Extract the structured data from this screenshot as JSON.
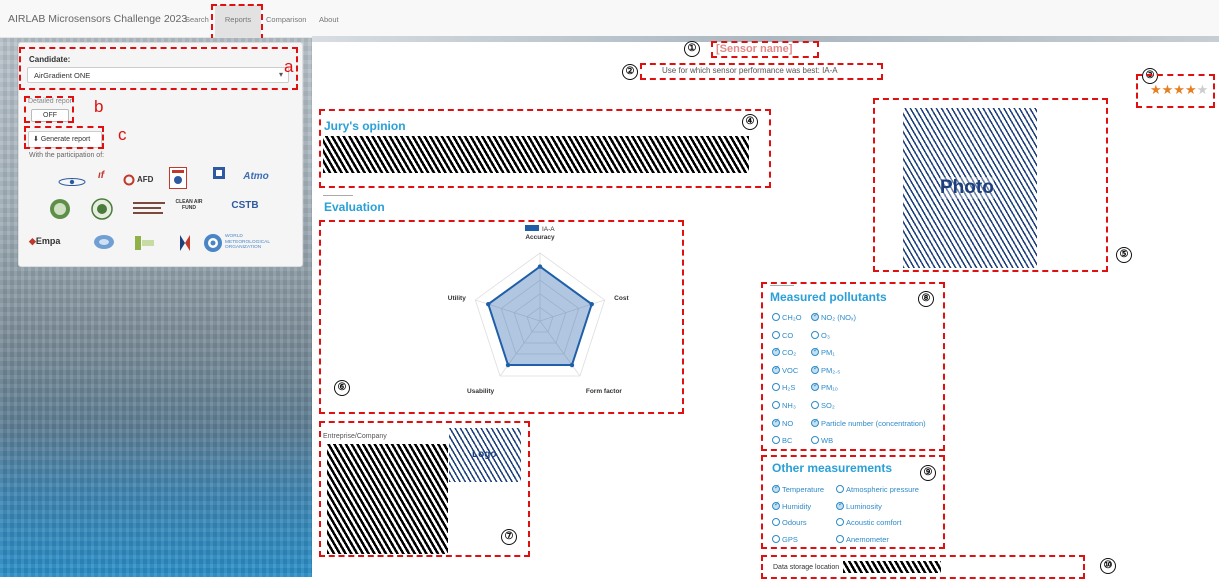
{
  "nav": {
    "brand": "AIRLAB Microsensors Challenge 2023",
    "items": [
      "Search",
      "Reports",
      "Comparison",
      "About"
    ]
  },
  "sidebar": {
    "candidate_label": "Candidate:",
    "candidate_value": "AirGradient ONE",
    "detailed_label": "Detailed report",
    "toggle_value": "OFF",
    "generate_label": "Generate report",
    "participation": "With the participation of:",
    "partner_logos": [
      "AFD",
      "Atmo",
      "CLEAN AIR FUND",
      "CSTB",
      "Empa",
      "WORLD METEOROLOGICAL ORGANIZATION"
    ]
  },
  "report": {
    "sensor_name": "[Sensor name]",
    "use_line": "Use for which sensor performance was best: IA-A",
    "stars": "★★★★",
    "star_empty": "★",
    "jury_title": "Jury's opinion",
    "evaluation_title": "Evaluation",
    "photo_label": "Photo",
    "company_label": "Entreprise/Company",
    "logo_label": "Logo",
    "pollutants_title": "Measured pollutants",
    "other_title": "Other measurements",
    "storage_label": "Data storage location"
  },
  "annotations": {
    "numbers": [
      "①",
      "②",
      "③",
      "④",
      "⑤",
      "⑥",
      "⑦",
      "⑧",
      "⑨",
      "⑩"
    ],
    "letters": [
      "a",
      "b",
      "c"
    ]
  },
  "chart_data": {
    "type": "radar",
    "legend": [
      "IA-A"
    ],
    "axes": [
      "Accuracy",
      "Cost",
      "Form factor",
      "Usability",
      "Utility"
    ],
    "series": [
      {
        "name": "IA-A",
        "values": [
          4,
          4,
          4,
          4,
          4
        ]
      }
    ],
    "max": 5,
    "color": "#1f5fa8"
  },
  "pollutants": [
    {
      "left": "CH₂O",
      "left_on": false,
      "right": "NO₂ (NOₓ)",
      "right_on": true
    },
    {
      "left": "CO",
      "left_on": false,
      "right": "O₃",
      "right_on": false
    },
    {
      "left": "CO₂",
      "left_on": true,
      "right": "PM₁",
      "right_on": true
    },
    {
      "left": "VOC",
      "left_on": true,
      "right": "PM₂.₅",
      "right_on": true
    },
    {
      "left": "H₂S",
      "left_on": false,
      "right": "PM₁₀",
      "right_on": true
    },
    {
      "left": "NH₃",
      "left_on": false,
      "right": "SO₂",
      "right_on": false
    },
    {
      "left": "NO",
      "left_on": true,
      "right": "Particle number (concentration)",
      "right_on": true
    },
    {
      "left": "BC",
      "left_on": false,
      "right": "WB",
      "right_on": false
    }
  ],
  "other_measurements": [
    {
      "left": "Temperature",
      "left_on": true,
      "right": "Atmospheric pressure",
      "right_on": false
    },
    {
      "left": "Humidity",
      "left_on": true,
      "right": "Luminosity",
      "right_on": true
    },
    {
      "left": "Odours",
      "left_on": false,
      "right": "Acoustic comfort",
      "right_on": false
    },
    {
      "left": "GPS",
      "left_on": false,
      "right": "Anemometer",
      "right_on": false
    }
  ]
}
